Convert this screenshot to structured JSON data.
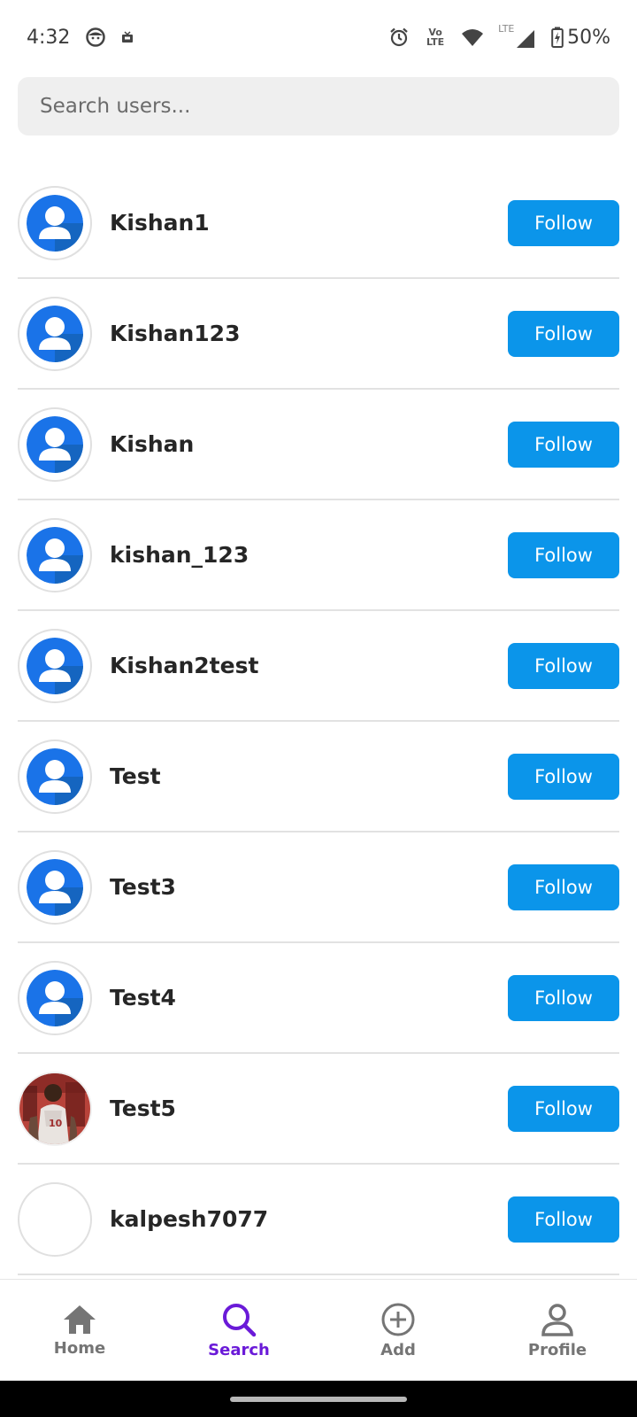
{
  "status_bar": {
    "time": "4:32",
    "battery": "50%",
    "network_label": "LTE",
    "volte_label": "Vo LTE"
  },
  "search": {
    "placeholder": "Search users..."
  },
  "users": [
    {
      "name": "Kishan1",
      "avatar": "default",
      "button": "Follow"
    },
    {
      "name": "Kishan123",
      "avatar": "default",
      "button": "Follow"
    },
    {
      "name": "Kishan",
      "avatar": "default",
      "button": "Follow"
    },
    {
      "name": "kishan_123",
      "avatar": "default",
      "button": "Follow"
    },
    {
      "name": "Kishan2test",
      "avatar": "default",
      "button": "Follow"
    },
    {
      "name": "Test",
      "avatar": "default",
      "button": "Follow"
    },
    {
      "name": "Test3",
      "avatar": "default",
      "button": "Follow"
    },
    {
      "name": "Test4",
      "avatar": "default",
      "button": "Follow"
    },
    {
      "name": "Test5",
      "avatar": "photo",
      "button": "Follow"
    },
    {
      "name": "kalpesh7077",
      "avatar": "empty",
      "button": "Follow"
    }
  ],
  "nav": {
    "items": [
      {
        "label": "Home",
        "icon": "home-icon"
      },
      {
        "label": "Search",
        "icon": "search-icon"
      },
      {
        "label": "Add",
        "icon": "add-circle-icon"
      },
      {
        "label": "Profile",
        "icon": "person-icon"
      }
    ],
    "active": "Search"
  },
  "colors": {
    "follow_button": "#0b95ea",
    "active_nav": "#6a1ad8",
    "inactive_nav": "#757575",
    "search_bg": "#efefef",
    "avatar_blue": "#1a73e8"
  }
}
